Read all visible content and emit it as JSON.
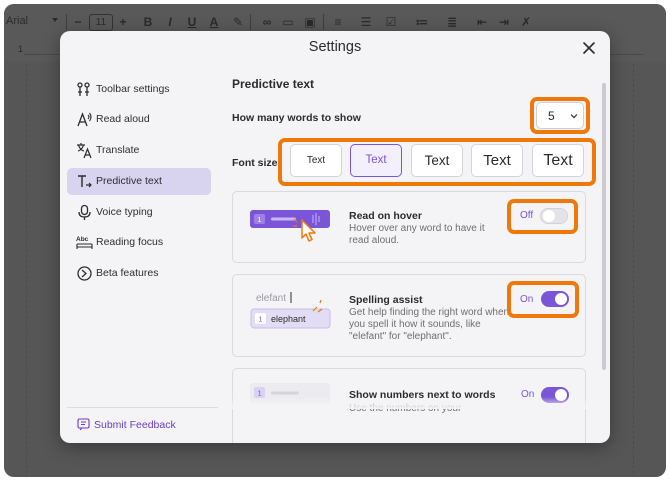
{
  "doc_toolbar": {
    "font_name": "Arial",
    "font_size": "11",
    "ruler_number": "1"
  },
  "dialog": {
    "title": "Settings",
    "close_label": "close"
  },
  "sidebar": {
    "items": [
      {
        "label": "Toolbar settings",
        "icon": "toolbar-settings-icon",
        "active": false
      },
      {
        "label": "Read aloud",
        "icon": "read-aloud-icon",
        "active": false
      },
      {
        "label": "Translate",
        "icon": "translate-icon",
        "active": false
      },
      {
        "label": "Predictive text",
        "icon": "predictive-text-icon",
        "active": true
      },
      {
        "label": "Voice typing",
        "icon": "microphone-icon",
        "active": false
      },
      {
        "label": "Reading focus",
        "icon": "reading-focus-icon",
        "active": false
      },
      {
        "label": "Beta features",
        "icon": "beta-features-icon",
        "active": false
      }
    ],
    "feedback_label": "Submit Feedback"
  },
  "main": {
    "section_title": "Predictive text",
    "words_label": "How many words to show",
    "words_value": "5",
    "font_size_label": "Font size",
    "font_size_options": [
      "Text",
      "Text",
      "Text",
      "Text",
      "Text"
    ],
    "font_size_selected": 1,
    "cards": [
      {
        "title": "Read on hover",
        "description": "Hover over any word to have it read aloud.",
        "toggle_label": "Off",
        "toggle_on": false,
        "preview_number": "1"
      },
      {
        "title": "Spelling assist",
        "description": "Get help finding the right word when you spell it how it sounds, like \"elefant\" for \"elephant\".",
        "toggle_label": "On",
        "toggle_on": true,
        "preview_typed": "elefant",
        "preview_suggestion": "elephant",
        "preview_number": "1"
      },
      {
        "title": "Show numbers next to words",
        "description": "Use the numbers on your",
        "toggle_label": "On",
        "toggle_on": true,
        "preview_number": "1"
      }
    ]
  },
  "colors": {
    "accent": "#7b55d8",
    "highlight": "#f0780a",
    "active_nav": "#d8d3ee"
  }
}
